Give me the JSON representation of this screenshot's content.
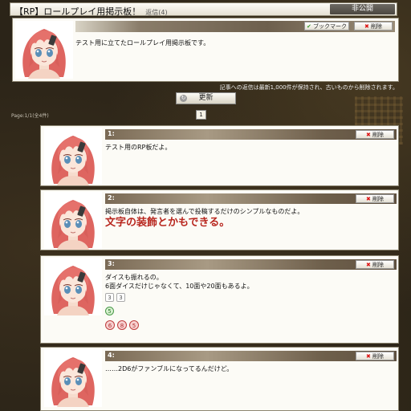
{
  "header": {
    "title": "【RP】ロールプレイ用掲示板！",
    "reply_count": "返信(4)",
    "private_label": "非公開"
  },
  "top_post": {
    "bookmark_label": "ブックマーク",
    "delete_label": "削除",
    "body": "テスト用に立てたロールプレイ用掲示板です。"
  },
  "notice": "記事への返信は最新1,000件が保持され、古いものから削除されます。",
  "refresh_label": "更新",
  "page_info": "Page:1/1(全4件)",
  "current_page": "1",
  "posts": [
    {
      "num": "1:",
      "delete_label": "削除",
      "line1": "テスト用のRP板だよ。"
    },
    {
      "num": "2:",
      "delete_label": "削除",
      "line1": "掲示板自体は、発言者を選んで投稿するだけのシンプルなものだよ。",
      "decorated": "文字の装飾とかもできる。"
    },
    {
      "num": "3:",
      "delete_label": "削除",
      "line1": "ダイスも振れるの。",
      "line2": "6面ダイスだけじゃなくて、10面や20面もあるよ。",
      "dice_d6": [
        "3",
        "3"
      ],
      "dice_d10": [
        "5"
      ],
      "dice_d20": [
        "6",
        "8",
        "5"
      ]
    },
    {
      "num": "4:",
      "delete_label": "削除",
      "line1": "……2D6がファンブルになってるんだけど。"
    }
  ],
  "colors": {
    "background": "#2c2519",
    "panel": "#fcfbf6",
    "accent_red": "#b8261e",
    "hair": "#e26a66"
  }
}
